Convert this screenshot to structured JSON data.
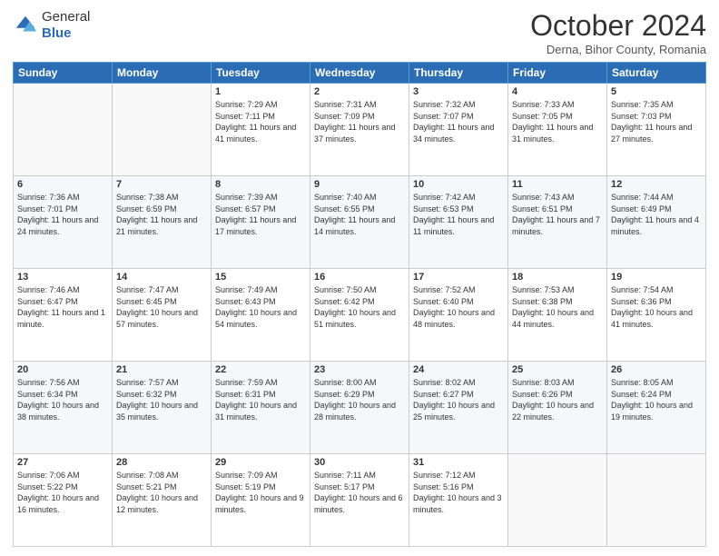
{
  "header": {
    "logo_general": "General",
    "logo_blue": "Blue",
    "month": "October 2024",
    "location": "Derna, Bihor County, Romania"
  },
  "days_of_week": [
    "Sunday",
    "Monday",
    "Tuesday",
    "Wednesday",
    "Thursday",
    "Friday",
    "Saturday"
  ],
  "weeks": [
    [
      {
        "day": "",
        "info": ""
      },
      {
        "day": "",
        "info": ""
      },
      {
        "day": "1",
        "info": "Sunrise: 7:29 AM\nSunset: 7:11 PM\nDaylight: 11 hours and 41 minutes."
      },
      {
        "day": "2",
        "info": "Sunrise: 7:31 AM\nSunset: 7:09 PM\nDaylight: 11 hours and 37 minutes."
      },
      {
        "day": "3",
        "info": "Sunrise: 7:32 AM\nSunset: 7:07 PM\nDaylight: 11 hours and 34 minutes."
      },
      {
        "day": "4",
        "info": "Sunrise: 7:33 AM\nSunset: 7:05 PM\nDaylight: 11 hours and 31 minutes."
      },
      {
        "day": "5",
        "info": "Sunrise: 7:35 AM\nSunset: 7:03 PM\nDaylight: 11 hours and 27 minutes."
      }
    ],
    [
      {
        "day": "6",
        "info": "Sunrise: 7:36 AM\nSunset: 7:01 PM\nDaylight: 11 hours and 24 minutes."
      },
      {
        "day": "7",
        "info": "Sunrise: 7:38 AM\nSunset: 6:59 PM\nDaylight: 11 hours and 21 minutes."
      },
      {
        "day": "8",
        "info": "Sunrise: 7:39 AM\nSunset: 6:57 PM\nDaylight: 11 hours and 17 minutes."
      },
      {
        "day": "9",
        "info": "Sunrise: 7:40 AM\nSunset: 6:55 PM\nDaylight: 11 hours and 14 minutes."
      },
      {
        "day": "10",
        "info": "Sunrise: 7:42 AM\nSunset: 6:53 PM\nDaylight: 11 hours and 11 minutes."
      },
      {
        "day": "11",
        "info": "Sunrise: 7:43 AM\nSunset: 6:51 PM\nDaylight: 11 hours and 7 minutes."
      },
      {
        "day": "12",
        "info": "Sunrise: 7:44 AM\nSunset: 6:49 PM\nDaylight: 11 hours and 4 minutes."
      }
    ],
    [
      {
        "day": "13",
        "info": "Sunrise: 7:46 AM\nSunset: 6:47 PM\nDaylight: 11 hours and 1 minute."
      },
      {
        "day": "14",
        "info": "Sunrise: 7:47 AM\nSunset: 6:45 PM\nDaylight: 10 hours and 57 minutes."
      },
      {
        "day": "15",
        "info": "Sunrise: 7:49 AM\nSunset: 6:43 PM\nDaylight: 10 hours and 54 minutes."
      },
      {
        "day": "16",
        "info": "Sunrise: 7:50 AM\nSunset: 6:42 PM\nDaylight: 10 hours and 51 minutes."
      },
      {
        "day": "17",
        "info": "Sunrise: 7:52 AM\nSunset: 6:40 PM\nDaylight: 10 hours and 48 minutes."
      },
      {
        "day": "18",
        "info": "Sunrise: 7:53 AM\nSunset: 6:38 PM\nDaylight: 10 hours and 44 minutes."
      },
      {
        "day": "19",
        "info": "Sunrise: 7:54 AM\nSunset: 6:36 PM\nDaylight: 10 hours and 41 minutes."
      }
    ],
    [
      {
        "day": "20",
        "info": "Sunrise: 7:56 AM\nSunset: 6:34 PM\nDaylight: 10 hours and 38 minutes."
      },
      {
        "day": "21",
        "info": "Sunrise: 7:57 AM\nSunset: 6:32 PM\nDaylight: 10 hours and 35 minutes."
      },
      {
        "day": "22",
        "info": "Sunrise: 7:59 AM\nSunset: 6:31 PM\nDaylight: 10 hours and 31 minutes."
      },
      {
        "day": "23",
        "info": "Sunrise: 8:00 AM\nSunset: 6:29 PM\nDaylight: 10 hours and 28 minutes."
      },
      {
        "day": "24",
        "info": "Sunrise: 8:02 AM\nSunset: 6:27 PM\nDaylight: 10 hours and 25 minutes."
      },
      {
        "day": "25",
        "info": "Sunrise: 8:03 AM\nSunset: 6:26 PM\nDaylight: 10 hours and 22 minutes."
      },
      {
        "day": "26",
        "info": "Sunrise: 8:05 AM\nSunset: 6:24 PM\nDaylight: 10 hours and 19 minutes."
      }
    ],
    [
      {
        "day": "27",
        "info": "Sunrise: 7:06 AM\nSunset: 5:22 PM\nDaylight: 10 hours and 16 minutes."
      },
      {
        "day": "28",
        "info": "Sunrise: 7:08 AM\nSunset: 5:21 PM\nDaylight: 10 hours and 12 minutes."
      },
      {
        "day": "29",
        "info": "Sunrise: 7:09 AM\nSunset: 5:19 PM\nDaylight: 10 hours and 9 minutes."
      },
      {
        "day": "30",
        "info": "Sunrise: 7:11 AM\nSunset: 5:17 PM\nDaylight: 10 hours and 6 minutes."
      },
      {
        "day": "31",
        "info": "Sunrise: 7:12 AM\nSunset: 5:16 PM\nDaylight: 10 hours and 3 minutes."
      },
      {
        "day": "",
        "info": ""
      },
      {
        "day": "",
        "info": ""
      }
    ]
  ]
}
